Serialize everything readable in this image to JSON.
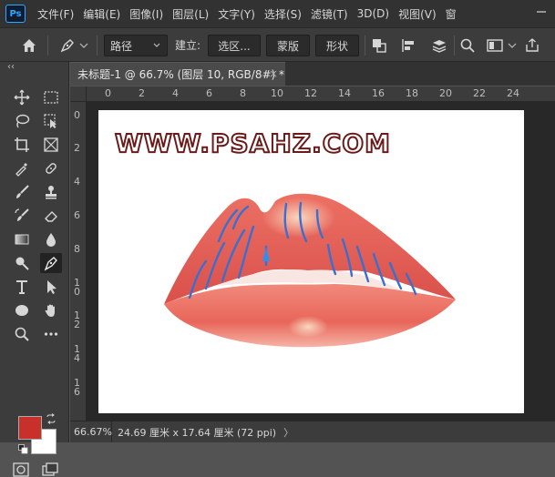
{
  "app": {
    "logo_text": "Ps"
  },
  "menu": [
    {
      "label": "文件(F)"
    },
    {
      "label": "编辑(E)"
    },
    {
      "label": "图像(I)"
    },
    {
      "label": "图层(L)"
    },
    {
      "label": "文字(Y)"
    },
    {
      "label": "选择(S)"
    },
    {
      "label": "滤镜(T)"
    },
    {
      "label": "3D(D)"
    },
    {
      "label": "视图(V)"
    },
    {
      "label": "窗"
    }
  ],
  "options": {
    "mode_select": "路径",
    "build_label": "建立:",
    "selection_button": "选区...",
    "mask_button": "蒙版",
    "shape_button": "形状"
  },
  "document": {
    "tab_title": "未标题-1 @ 66.7% (图层 10, RGB/8#) *",
    "close_glyph": "×",
    "watermark": "WWW.PSAHZ.COM"
  },
  "ruler": {
    "horizontal_ticks": [
      "0",
      "2",
      "4",
      "6",
      "8",
      "10",
      "12",
      "14",
      "16",
      "18",
      "20",
      "22",
      "24"
    ],
    "vertical_ticks": [
      "0",
      "2",
      "4",
      "6",
      "8",
      "10",
      "12",
      "14",
      "16"
    ]
  },
  "status": {
    "zoom": "66.67%",
    "doc_info": "24.69 厘米 x 17.64 厘米 (72 ppi)",
    "arrow": "〉"
  },
  "colors": {
    "foreground": "#c8302c",
    "background": "#ffffff",
    "lip_base": "#e8665a",
    "lip_line": "#3a6fd0"
  },
  "toolbar": {
    "collapse_glyph": "‹‹",
    "tools": [
      "move-tool",
      "marquee-tool",
      "lasso-tool",
      "object-select-tool",
      "crop-tool",
      "frame-tool",
      "eyedropper-tool",
      "healing-brush-tool",
      "brush-tool",
      "clone-stamp-tool",
      "history-brush-tool",
      "eraser-tool",
      "gradient-tool",
      "blur-tool",
      "dodge-tool",
      "pen-tool",
      "type-tool",
      "path-select-tool",
      "ellipse-tool",
      "hand-tool",
      "zoom-tool",
      "more-tools"
    ]
  }
}
